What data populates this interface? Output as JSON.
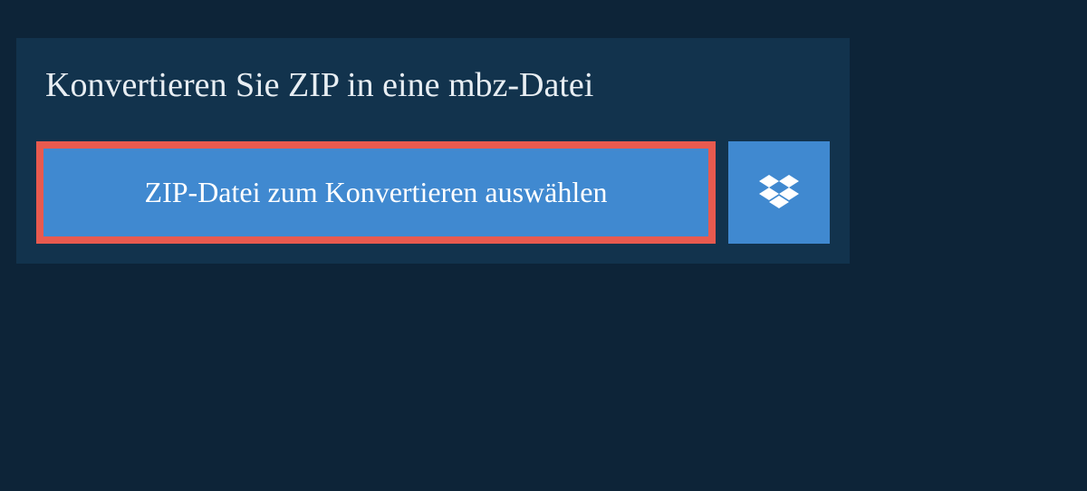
{
  "header": {
    "title": "Konvertieren Sie ZIP in eine mbz-Datei"
  },
  "upload": {
    "select_button_label": "ZIP-Datei zum Konvertieren auswählen"
  }
}
